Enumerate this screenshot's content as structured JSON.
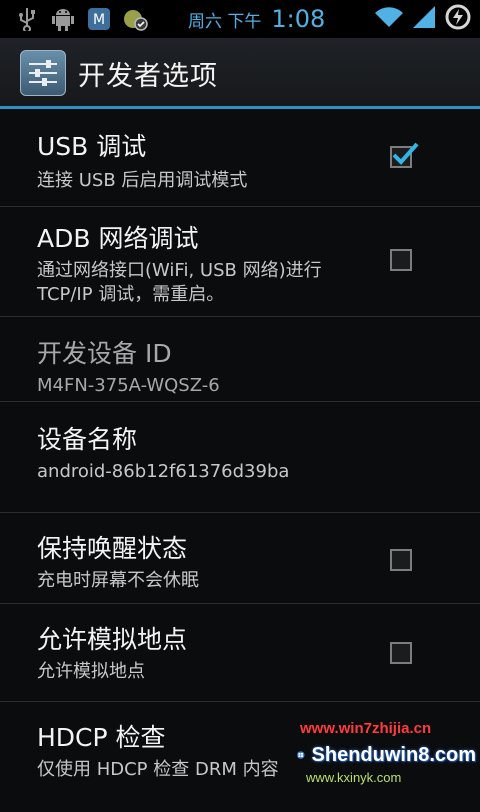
{
  "status_bar": {
    "icons_left": [
      "usb-icon",
      "android-debug-icon",
      "app-notification-icon",
      "recycle-notification-icon"
    ],
    "date": "周六 下午",
    "time": "1:08",
    "icons_right": [
      "wifi-icon",
      "signal-icon",
      "battery-charging-icon"
    ]
  },
  "action_bar": {
    "title": "开发者选项",
    "icon": "settings-sliders-icon"
  },
  "accent_color": "#33b5e5",
  "items": [
    {
      "title": "USB 调试",
      "summary": "连接 USB 后启用调试模式",
      "checked": true
    },
    {
      "title": "ADB 网络调试",
      "summary": "通过网络接口(WiFi, USB 网络)进行\nTCP/IP 调试，需重启。",
      "checked": false
    },
    {
      "title": "开发设备 ID",
      "summary": "M4FN-375A-WQSZ-6",
      "disabled": true
    },
    {
      "title": "设备名称",
      "summary": "android-86b12f61376d39ba"
    },
    {
      "title": "保持唤醒状态",
      "summary": "充电时屏幕不会休眠",
      "checked": false
    },
    {
      "title": "允许模拟地点",
      "summary": "允许模拟地点",
      "checked": false
    },
    {
      "title": "HDCP 检查",
      "summary": "仅使用 HDCP 检查 DRM 内容"
    }
  ],
  "watermark": {
    "top": "www.win7zhijia.cn",
    "logo": "Shenduwin8.com",
    "bottom": "www.kxinyk.com"
  }
}
